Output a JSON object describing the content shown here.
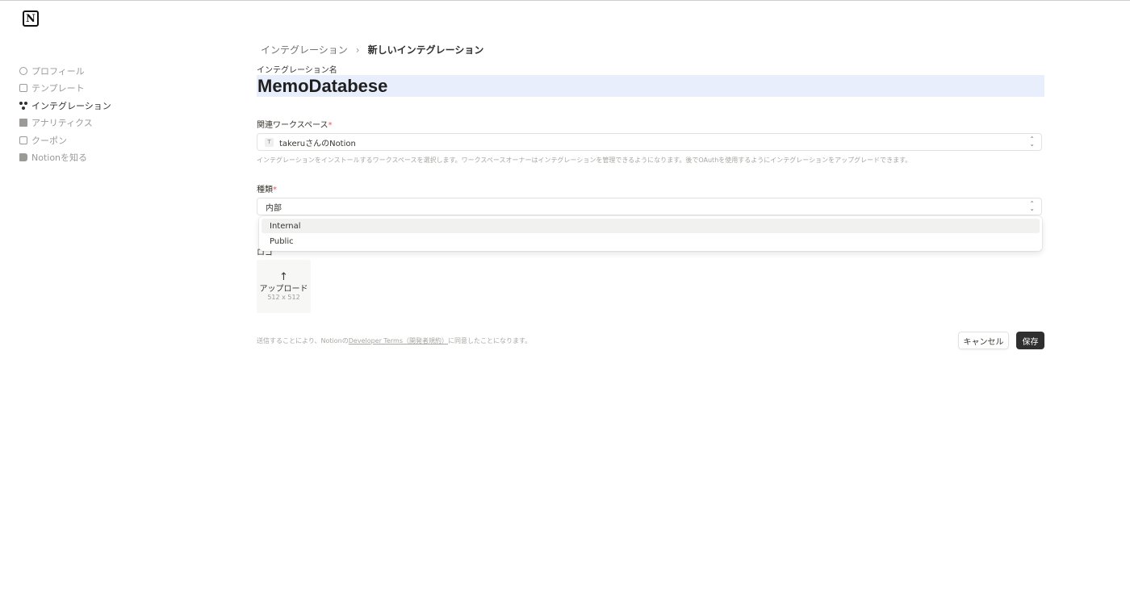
{
  "app": {
    "logo_text": "N"
  },
  "sidebar": {
    "items": [
      {
        "label": "プロフィール",
        "icon": "profile-icon"
      },
      {
        "label": "テンプレート",
        "icon": "template-icon"
      },
      {
        "label": "インテグレーション",
        "icon": "integration-icon",
        "active": true
      },
      {
        "label": "アナリティクス",
        "icon": "analytics-icon"
      },
      {
        "label": "クーポン",
        "icon": "coupon-icon"
      },
      {
        "label": "Notionを知る",
        "icon": "book-icon"
      }
    ]
  },
  "breadcrumb": {
    "parent": "インテグレーション",
    "separator": "›",
    "current": "新しいインテグレーション"
  },
  "form": {
    "name_label": "インテグレーション名",
    "name_value": "MemoDatabese",
    "workspace_label": "関連ワークスペース",
    "required_mark": "*",
    "workspace_badge": "T",
    "workspace_value": "takeruさんのNotion",
    "workspace_help": "インテグレーションをインストールするワークスペースを選択します。ワークスペースオーナーはインテグレーションを管理できるようになります。後でOAuthを使用するようにインテグレーションをアップグレードできます。",
    "type_label": "種類",
    "type_value": "内部",
    "type_options": [
      "Internal",
      "Public"
    ],
    "logo_label": "ロゴ",
    "upload_icon": "↑",
    "upload_label": "アップロード",
    "upload_size": "512 x 512",
    "terms_prefix": "送信することにより、Notionの",
    "terms_link": "Developer Terms（開発者規約）",
    "terms_suffix": "に同意したことになります。",
    "cancel_label": "キャンセル",
    "save_label": "保存"
  },
  "colors": {
    "name_highlight": "#e8eefb",
    "save_bg": "#2f2f2f",
    "required": "#eb5757"
  }
}
